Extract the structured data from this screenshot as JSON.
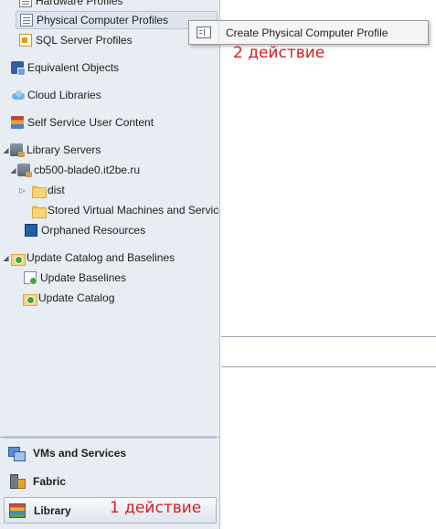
{
  "tree": {
    "hardware_profiles": "Hardware Profiles",
    "physical_computer_profiles": "Physical Computer Profiles",
    "sql_server_profiles": "SQL Server Profiles",
    "equivalent_objects": "Equivalent Objects",
    "cloud_libraries": "Cloud Libraries",
    "self_service_user_content": "Self Service User Content",
    "library_servers": "Library Servers",
    "library_server_host": "cb500-blade0.it2be.ru",
    "dist_folder": "dist",
    "stored_vms_folder": "Stored Virtual Machines and Services",
    "orphaned_resources": "Orphaned Resources",
    "update_catalog_and_baselines": "Update Catalog and Baselines",
    "update_baselines": "Update Baselines",
    "update_catalog": "Update Catalog"
  },
  "wunderbar": {
    "vms_and_services": "VMs and Services",
    "fabric": "Fabric",
    "library": "Library"
  },
  "context_menu": {
    "create_physical_computer_profile": "Create Physical Computer Profile"
  },
  "annotations": {
    "step1": "1 действие",
    "step2": "2 действие",
    "color": "#d11f1f"
  }
}
